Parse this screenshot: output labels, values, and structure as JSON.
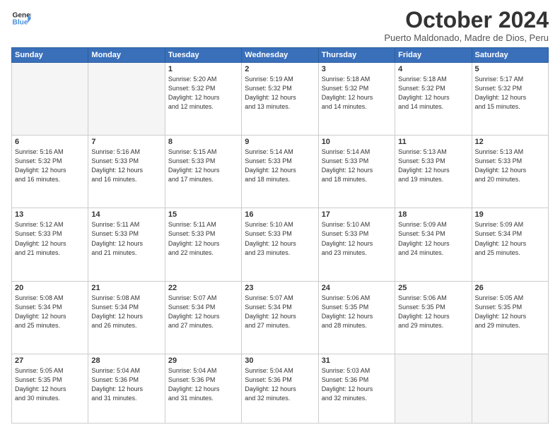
{
  "header": {
    "logo_line1": "General",
    "logo_line2": "Blue",
    "title": "October 2024",
    "location": "Puerto Maldonado, Madre de Dios, Peru"
  },
  "days_of_week": [
    "Sunday",
    "Monday",
    "Tuesday",
    "Wednesday",
    "Thursday",
    "Friday",
    "Saturday"
  ],
  "weeks": [
    [
      {
        "day": "",
        "info": ""
      },
      {
        "day": "",
        "info": ""
      },
      {
        "day": "1",
        "info": "Sunrise: 5:20 AM\nSunset: 5:32 PM\nDaylight: 12 hours\nand 12 minutes."
      },
      {
        "day": "2",
        "info": "Sunrise: 5:19 AM\nSunset: 5:32 PM\nDaylight: 12 hours\nand 13 minutes."
      },
      {
        "day": "3",
        "info": "Sunrise: 5:18 AM\nSunset: 5:32 PM\nDaylight: 12 hours\nand 14 minutes."
      },
      {
        "day": "4",
        "info": "Sunrise: 5:18 AM\nSunset: 5:32 PM\nDaylight: 12 hours\nand 14 minutes."
      },
      {
        "day": "5",
        "info": "Sunrise: 5:17 AM\nSunset: 5:32 PM\nDaylight: 12 hours\nand 15 minutes."
      }
    ],
    [
      {
        "day": "6",
        "info": "Sunrise: 5:16 AM\nSunset: 5:32 PM\nDaylight: 12 hours\nand 16 minutes."
      },
      {
        "day": "7",
        "info": "Sunrise: 5:16 AM\nSunset: 5:33 PM\nDaylight: 12 hours\nand 16 minutes."
      },
      {
        "day": "8",
        "info": "Sunrise: 5:15 AM\nSunset: 5:33 PM\nDaylight: 12 hours\nand 17 minutes."
      },
      {
        "day": "9",
        "info": "Sunrise: 5:14 AM\nSunset: 5:33 PM\nDaylight: 12 hours\nand 18 minutes."
      },
      {
        "day": "10",
        "info": "Sunrise: 5:14 AM\nSunset: 5:33 PM\nDaylight: 12 hours\nand 18 minutes."
      },
      {
        "day": "11",
        "info": "Sunrise: 5:13 AM\nSunset: 5:33 PM\nDaylight: 12 hours\nand 19 minutes."
      },
      {
        "day": "12",
        "info": "Sunrise: 5:13 AM\nSunset: 5:33 PM\nDaylight: 12 hours\nand 20 minutes."
      }
    ],
    [
      {
        "day": "13",
        "info": "Sunrise: 5:12 AM\nSunset: 5:33 PM\nDaylight: 12 hours\nand 21 minutes."
      },
      {
        "day": "14",
        "info": "Sunrise: 5:11 AM\nSunset: 5:33 PM\nDaylight: 12 hours\nand 21 minutes."
      },
      {
        "day": "15",
        "info": "Sunrise: 5:11 AM\nSunset: 5:33 PM\nDaylight: 12 hours\nand 22 minutes."
      },
      {
        "day": "16",
        "info": "Sunrise: 5:10 AM\nSunset: 5:33 PM\nDaylight: 12 hours\nand 23 minutes."
      },
      {
        "day": "17",
        "info": "Sunrise: 5:10 AM\nSunset: 5:33 PM\nDaylight: 12 hours\nand 23 minutes."
      },
      {
        "day": "18",
        "info": "Sunrise: 5:09 AM\nSunset: 5:34 PM\nDaylight: 12 hours\nand 24 minutes."
      },
      {
        "day": "19",
        "info": "Sunrise: 5:09 AM\nSunset: 5:34 PM\nDaylight: 12 hours\nand 25 minutes."
      }
    ],
    [
      {
        "day": "20",
        "info": "Sunrise: 5:08 AM\nSunset: 5:34 PM\nDaylight: 12 hours\nand 25 minutes."
      },
      {
        "day": "21",
        "info": "Sunrise: 5:08 AM\nSunset: 5:34 PM\nDaylight: 12 hours\nand 26 minutes."
      },
      {
        "day": "22",
        "info": "Sunrise: 5:07 AM\nSunset: 5:34 PM\nDaylight: 12 hours\nand 27 minutes."
      },
      {
        "day": "23",
        "info": "Sunrise: 5:07 AM\nSunset: 5:34 PM\nDaylight: 12 hours\nand 27 minutes."
      },
      {
        "day": "24",
        "info": "Sunrise: 5:06 AM\nSunset: 5:35 PM\nDaylight: 12 hours\nand 28 minutes."
      },
      {
        "day": "25",
        "info": "Sunrise: 5:06 AM\nSunset: 5:35 PM\nDaylight: 12 hours\nand 29 minutes."
      },
      {
        "day": "26",
        "info": "Sunrise: 5:05 AM\nSunset: 5:35 PM\nDaylight: 12 hours\nand 29 minutes."
      }
    ],
    [
      {
        "day": "27",
        "info": "Sunrise: 5:05 AM\nSunset: 5:35 PM\nDaylight: 12 hours\nand 30 minutes."
      },
      {
        "day": "28",
        "info": "Sunrise: 5:04 AM\nSunset: 5:36 PM\nDaylight: 12 hours\nand 31 minutes."
      },
      {
        "day": "29",
        "info": "Sunrise: 5:04 AM\nSunset: 5:36 PM\nDaylight: 12 hours\nand 31 minutes."
      },
      {
        "day": "30",
        "info": "Sunrise: 5:04 AM\nSunset: 5:36 PM\nDaylight: 12 hours\nand 32 minutes."
      },
      {
        "day": "31",
        "info": "Sunrise: 5:03 AM\nSunset: 5:36 PM\nDaylight: 12 hours\nand 32 minutes."
      },
      {
        "day": "",
        "info": ""
      },
      {
        "day": "",
        "info": ""
      }
    ]
  ]
}
